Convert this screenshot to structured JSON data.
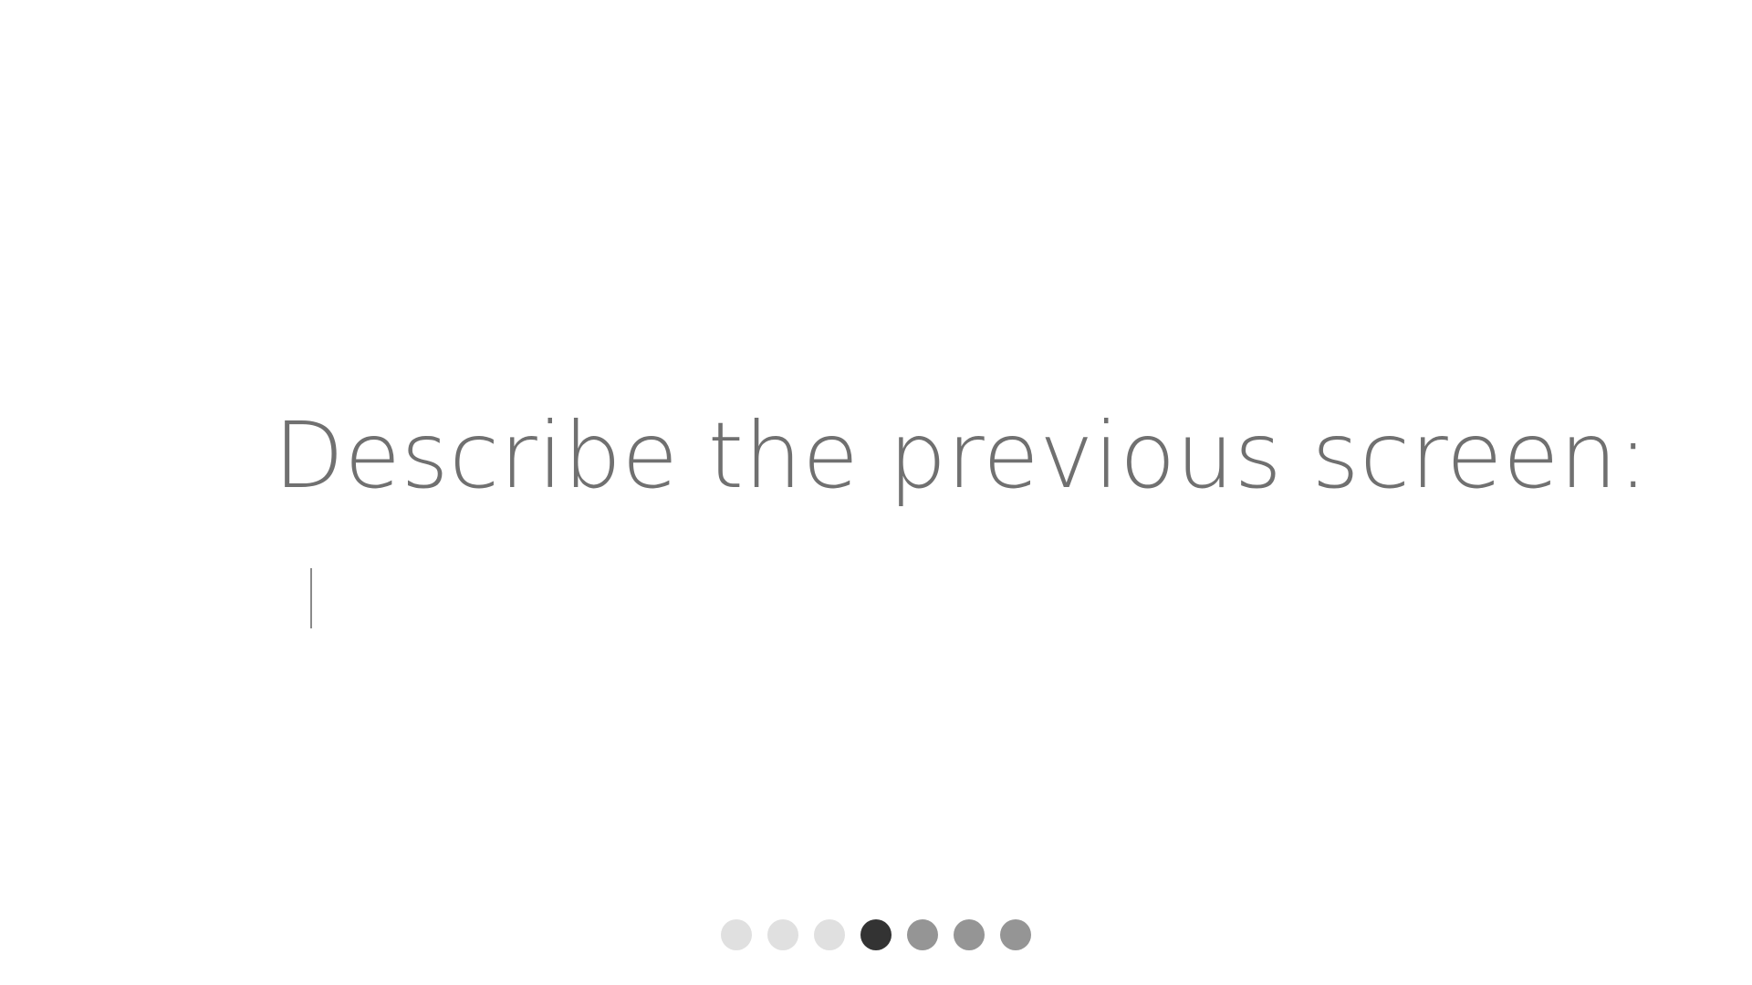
{
  "prompt": {
    "title": "Describe the previous screen:",
    "input_value": "",
    "input_placeholder": ""
  },
  "pagination": {
    "total": 7,
    "current_index": 4,
    "dots": [
      {
        "state": "completed",
        "color": "#e0e0e0"
      },
      {
        "state": "completed",
        "color": "#e0e0e0"
      },
      {
        "state": "completed",
        "color": "#e0e0e0"
      },
      {
        "state": "current",
        "color": "#333333"
      },
      {
        "state": "upcoming",
        "color": "#959595"
      },
      {
        "state": "upcoming",
        "color": "#959595"
      },
      {
        "state": "upcoming",
        "color": "#959595"
      }
    ]
  },
  "colors": {
    "text": "#707070",
    "background": "#ffffff"
  }
}
